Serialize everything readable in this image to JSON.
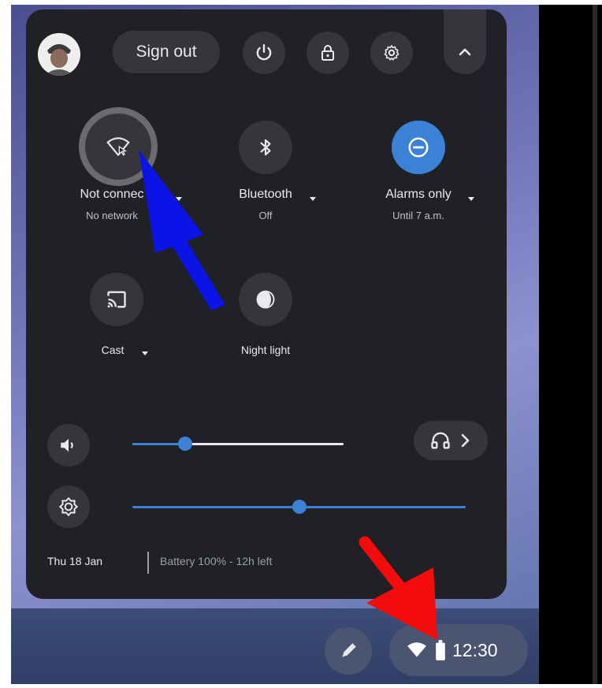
{
  "header": {
    "sign_out_label": "Sign out",
    "buttons": [
      {
        "icon": "power-icon"
      },
      {
        "icon": "lock-icon"
      },
      {
        "icon": "gear-icon"
      },
      {
        "icon": "chevron-up-icon"
      }
    ]
  },
  "features": [
    {
      "label": "Not connec",
      "sub": "No network",
      "icon": "wifi-off-icon",
      "active": false
    },
    {
      "label": "Bluetooth",
      "sub": "Off",
      "icon": "bluetooth-icon",
      "active": false
    },
    {
      "label": "Alarms only",
      "sub": "Until 7 a.m.",
      "icon": "do-not-disturb-icon",
      "active": true
    },
    {
      "label": "Cast",
      "sub": "",
      "icon": "cast-icon",
      "active": false
    },
    {
      "label": "Night light",
      "sub": "",
      "icon": "night-light-icon",
      "active": false
    }
  ],
  "sliders": {
    "volume": {
      "value": 0.25,
      "icon": "volume-icon"
    },
    "brightness": {
      "value": 0.5,
      "icon": "brightness-icon"
    },
    "audio_output_icon": "headphones-icon"
  },
  "footer": {
    "date": "Thu 18 Jan",
    "battery": "Battery 100% - 12h left"
  },
  "shelf": {
    "time": "12:30",
    "icons": [
      "stylus-icon",
      "wifi-icon",
      "battery-icon"
    ]
  },
  "colors": {
    "panel": "#202124",
    "button": "#35363a",
    "accent": "#3b82d6",
    "annotation_blue": "#0a14e6",
    "annotation_red": "#f40c0c"
  }
}
